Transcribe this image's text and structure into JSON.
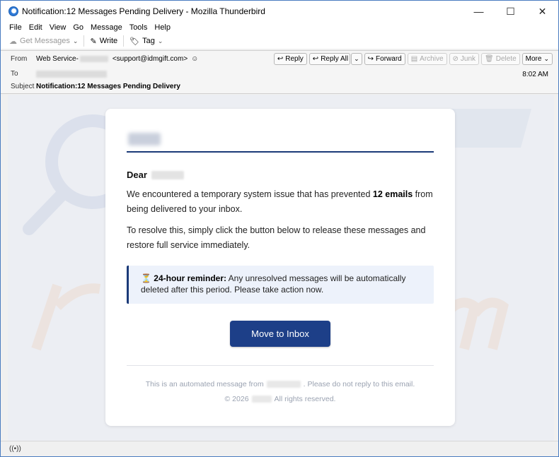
{
  "window": {
    "title": "Notification:12 Messages Pending Delivery - Mozilla Thunderbird",
    "controls": {
      "minimize": "—",
      "maximize": "☐",
      "close": "✕"
    }
  },
  "menu": {
    "items": [
      {
        "label": "File"
      },
      {
        "label": "Edit"
      },
      {
        "label": "View"
      },
      {
        "label": "Go"
      },
      {
        "label": "Message"
      },
      {
        "label": "Tools"
      },
      {
        "label": "Help"
      }
    ]
  },
  "toolbar": {
    "get_messages": "Get Messages",
    "write": "Write",
    "tag": "Tag"
  },
  "header": {
    "from_label": "From",
    "from_name": "Web Service-",
    "from_email": "<support@idmgift.com>",
    "to_label": "To",
    "subject_label": "Subject",
    "subject": "Notification:12 Messages Pending Delivery",
    "time": "8:02 AM",
    "buttons": {
      "reply": "Reply",
      "reply_all": "Reply All",
      "forward": "Forward",
      "archive": "Archive",
      "junk": "Junk",
      "delete": "Delete",
      "more": "More"
    }
  },
  "email": {
    "greeting": "Dear",
    "para1_a": "We encountered a temporary system issue that has prevented ",
    "para1_bold": "12 emails",
    "para1_b": " from being delivered to your inbox.",
    "para2": "To resolve this, simply click the button below to release these messages and restore full service immediately.",
    "reminder_icon": "⏳",
    "reminder_bold": "24-hour reminder:",
    "reminder_text": " Any unresolved messages will be automatically deleted after this period. Please take action now.",
    "cta": "Move to Inbox",
    "footer_a": "This is an automated message from",
    "footer_b": ". Please do not reply to this email.",
    "copyright_a": "© 2026",
    "copyright_b": "All rights reserved."
  },
  "colors": {
    "accent": "#1d3f88",
    "rule": "#1b3a78",
    "reminder_bg": "#edf2fb"
  }
}
